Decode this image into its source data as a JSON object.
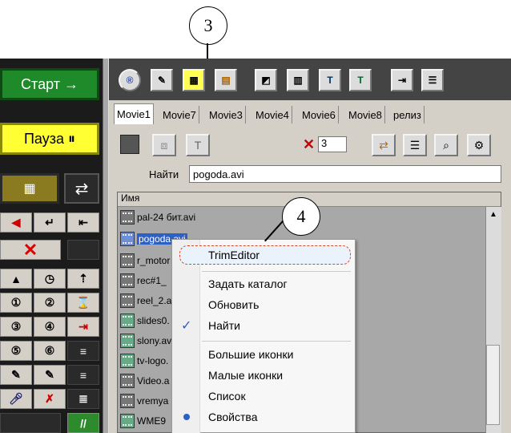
{
  "left_panel": {
    "start_label": "Старт →",
    "pause_label": "Пауза ⏸"
  },
  "tabs": [
    "Movie1",
    "Movie7",
    "Movie3",
    "Movie4",
    "Movie6",
    "Movie8",
    "релиз"
  ],
  "panel": {
    "counter_value": "3",
    "search_label": "Найти",
    "search_value": "pogoda.avi",
    "column_header": "Имя"
  },
  "files": [
    "pal-24 бит.avi",
    "pogoda.avi",
    "r_motor",
    "rec#1_",
    "reel_2.a",
    "slides0.",
    "slony.av",
    "tv-logo.",
    "Video.a",
    "vremya",
    "WME9"
  ],
  "context_menu": {
    "items": [
      "TrimEditor",
      "Задать каталог",
      "Обновить",
      "Найти",
      "Большие иконки",
      "Малые иконки",
      "Список",
      "Свойства"
    ]
  },
  "callouts": {
    "toolbar_marker": "3",
    "menu_marker": "4"
  },
  "colors": {
    "start": "#1f8a2a",
    "pause": "#ffff33",
    "selection": "#2d5fc4",
    "highlight_border": "#d64a2a"
  }
}
